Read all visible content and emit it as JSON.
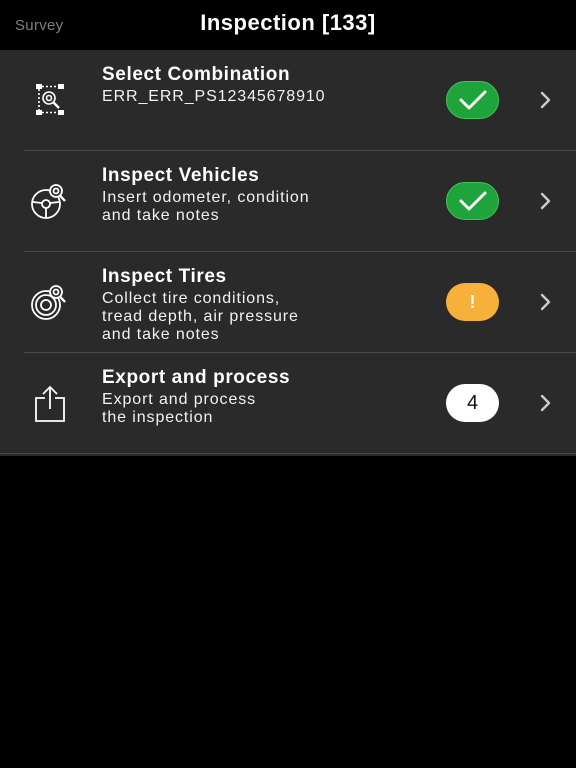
{
  "header": {
    "back_label": "Survey",
    "title": "Inspection [133]"
  },
  "colors": {
    "check_green": "#1ea43a",
    "warning_orange": "#f7b13b",
    "count_white": "#ffffff",
    "list_background": "#2a2a2a"
  },
  "rows": [
    {
      "title": "Select Combination",
      "subtitle": "ERR_ERR_PS12345678910",
      "icon": "combination-icon",
      "status": "check"
    },
    {
      "title": "Inspect Vehicles",
      "subtitle": "Insert odometer, condition\nand take notes",
      "icon": "steering-wheel-icon",
      "status": "check"
    },
    {
      "title": "Inspect Tires",
      "subtitle": "Collect tire conditions,\ntread depth, air pressure\nand take notes",
      "icon": "tire-icon",
      "status": "warning",
      "status_text": "!"
    },
    {
      "title": "Export and process",
      "subtitle": "Export and process\nthe inspection",
      "icon": "share-icon",
      "status": "count",
      "status_text": "4"
    }
  ]
}
